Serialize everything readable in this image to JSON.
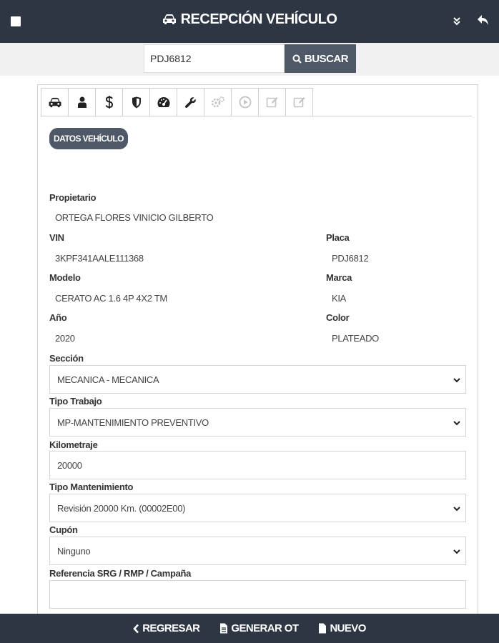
{
  "header": {
    "title": "RECEPCIÓN VEHÍCULO",
    "menu_icon": "menu-icon",
    "collapse_icon": "double-chevron-down-icon",
    "back_icon": "reply-arrow-icon"
  },
  "search": {
    "value": "PDJ6812",
    "button_label": "BUSCAR"
  },
  "tabs": [
    {
      "icon": "car-icon",
      "active": true
    },
    {
      "icon": "user-icon"
    },
    {
      "icon": "dollar-icon"
    },
    {
      "icon": "shield-icon"
    },
    {
      "icon": "gauge-icon"
    },
    {
      "icon": "wrench-icon"
    },
    {
      "icon": "gears-icon",
      "disabled": true
    },
    {
      "icon": "play-circle-icon",
      "disabled": true
    },
    {
      "icon": "edit-icon",
      "disabled": true
    },
    {
      "icon": "edit-icon",
      "disabled": true
    }
  ],
  "section_title": "DATOS VEHÍCULO",
  "vehicle": {
    "owner_label": "Propietario",
    "owner": "ORTEGA FLORES VINICIO GILBERTO",
    "vin_label": "VIN",
    "vin": "3KPF341AALE111368",
    "plate_label": "Placa",
    "plate": "PDJ6812",
    "model_label": "Modelo",
    "model": "CERATO AC 1.6 4P 4X2 TM",
    "brand_label": "Marca",
    "brand": "KIA",
    "year_label": "Año",
    "year": "2020",
    "color_label": "Color",
    "color": "PLATEADO"
  },
  "form": {
    "section_label": "Sección",
    "section_value": "MECANICA - MECANICA",
    "work_type_label": "Tipo Trabajo",
    "work_type_value": "MP-MANTENIMIENTO PREVENTIVO",
    "mileage_label": "Kilometraje",
    "mileage_value": "20000",
    "maintenance_label": "Tipo Mantenimiento",
    "maintenance_value": "Revisión 20000 Km. (00002E00)",
    "coupon_label": "Cupón",
    "coupon_value": "Ninguno",
    "reference_label": "Referencia SRG / RMP / Campaña",
    "reference_value": ""
  },
  "footer": {
    "back_label": "REGRESAR",
    "generate_label": "GENERAR OT",
    "new_label": "NUEVO"
  },
  "colors": {
    "header_bg": "#2e3543",
    "button_bg": "#4e5866"
  }
}
